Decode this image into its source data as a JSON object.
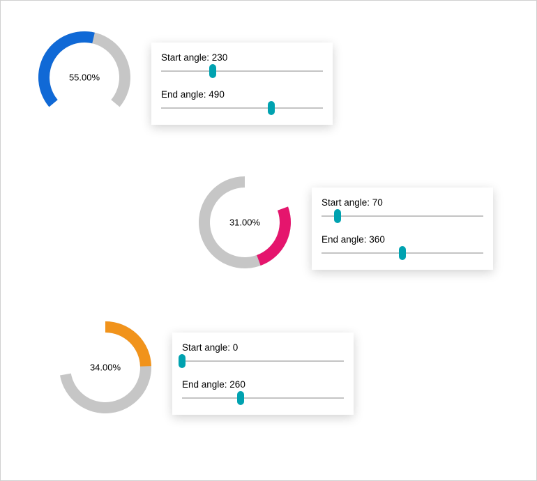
{
  "chart_data": [
    {
      "type": "pie",
      "subtype": "radial-gauge",
      "value_percent": 55.0,
      "start_angle_deg": 230,
      "end_angle_deg": 490,
      "color": "#1069d6",
      "track_color": "#c6c6c6",
      "label": "55.00%"
    },
    {
      "type": "pie",
      "subtype": "radial-gauge",
      "value_percent": 31.0,
      "start_angle_deg": 70,
      "end_angle_deg": 360,
      "color": "#e5156d",
      "track_color": "#c6c6c6",
      "label": "31.00%"
    },
    {
      "type": "pie",
      "subtype": "radial-gauge",
      "value_percent": 34.0,
      "start_angle_deg": 0,
      "end_angle_deg": 260,
      "color": "#f1931b",
      "track_color": "#c6c6c6",
      "label": "34.00%"
    }
  ],
  "gauges": [
    {
      "percent_label": "55.00%",
      "controls": {
        "start_label": "Start angle: 230",
        "start_value": 230,
        "start_min": 0,
        "start_max": 720,
        "end_label": "End angle: 490",
        "end_value": 490,
        "end_min": 0,
        "end_max": 720
      }
    },
    {
      "percent_label": "31.00%",
      "controls": {
        "start_label": "Start angle: 70",
        "start_value": 70,
        "start_min": 0,
        "start_max": 720,
        "end_label": "End angle: 360",
        "end_value": 360,
        "end_min": 0,
        "end_max": 720
      }
    },
    {
      "percent_label": "34.00%",
      "controls": {
        "start_label": "Start angle: 0",
        "start_value": 0,
        "start_min": 0,
        "start_max": 720,
        "end_label": "End angle: 260",
        "end_value": 260,
        "end_min": 0,
        "end_max": 720
      }
    }
  ]
}
